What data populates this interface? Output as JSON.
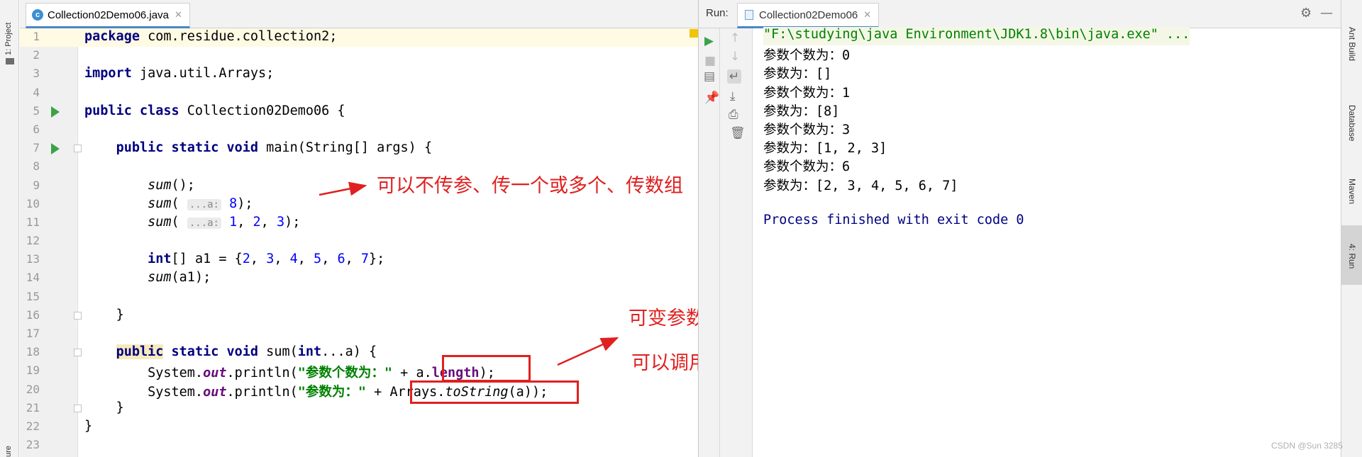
{
  "left_strip": {
    "project_label": "1: Project",
    "structure_label": "ure"
  },
  "editor": {
    "tab_label": "Collection02Demo06.java",
    "tab_icon_letter": "c",
    "lines": [
      {
        "no": "1"
      },
      {
        "no": "2"
      },
      {
        "no": "3"
      },
      {
        "no": "4"
      },
      {
        "no": "5"
      },
      {
        "no": "6"
      },
      {
        "no": "7"
      },
      {
        "no": "8"
      },
      {
        "no": "9"
      },
      {
        "no": "10"
      },
      {
        "no": "11"
      },
      {
        "no": "12"
      },
      {
        "no": "13"
      },
      {
        "no": "14"
      },
      {
        "no": "15"
      },
      {
        "no": "16"
      },
      {
        "no": "17"
      },
      {
        "no": "18"
      },
      {
        "no": "19"
      },
      {
        "no": "20"
      },
      {
        "no": "21"
      },
      {
        "no": "22"
      },
      {
        "no": "23"
      }
    ],
    "code": {
      "l1_kw": "package",
      "l1_rest": " com.residue.collection2;",
      "l3_kw": "import",
      "l3_rest": " java.util.Arrays;",
      "l5_kw": "public class",
      "l5_rest": " Collection02Demo06 {",
      "l7_ind": "    ",
      "l7_kw": "public static void",
      "l7_rest": " main(String[] args) {",
      "l9_ind": "        ",
      "l9_fn": "sum",
      "l9_rest": "();",
      "l10_ind": "        ",
      "l10_fn": "sum",
      "l10_open": "( ",
      "l10_hint": "...a:",
      "l10_num": " 8",
      "l10_close": ");",
      "l11_ind": "        ",
      "l11_fn": "sum",
      "l11_open": "( ",
      "l11_hint": "...a:",
      "l11_n1": " 1",
      "l11_c1": ", ",
      "l11_n2": "2",
      "l11_c2": ", ",
      "l11_n3": "3",
      "l11_close": ");",
      "l13_ind": "        ",
      "l13_kw": "int",
      "l13_a": "[] a1 = {",
      "l13_n1": "2",
      "l13_n2": "3",
      "l13_n3": "4",
      "l13_n4": "5",
      "l13_n5": "6",
      "l13_n6": "7",
      "l13_sep": ", ",
      "l13_end": "};",
      "l14_ind": "        ",
      "l14_fn": "sum",
      "l14_rest": "(a1);",
      "l16_ind": "    ",
      "l16_rest": "}",
      "l18_ind": "    ",
      "l18_kw1": "public",
      "l18_kw2": " static void",
      "l18_a": " sum(",
      "l18_kw3": "int",
      "l18_b": "...a) {",
      "l19_ind": "        ",
      "l19_a": "System.",
      "l19_out": "out",
      "l19_b": ".println(",
      "l19_str": "\"参数个数为：\"",
      "l19_c": " + a.",
      "l19_len": "length",
      "l19_d": ");",
      "l20_ind": "        ",
      "l20_a": "System.",
      "l20_out": "out",
      "l20_b": ".println(",
      "l20_str": "\"参数为：\"",
      "l20_c": " + Arrays.",
      "l20_fn": "toString",
      "l20_d": "(a));",
      "l21_ind": "    ",
      "l21_rest": "}",
      "l22_rest": "}"
    }
  },
  "annotations": {
    "a1": "可以不传参、传一个或多个、传数组",
    "a2": "可变参数在方法内部其实就是一个数组",
    "a3": "可以调用数组的方法"
  },
  "run_panel": {
    "label": "Run:",
    "tab_label": "Collection02Demo06",
    "console": [
      "\"F:\\studying\\java Environment\\JDK1.8\\bin\\java.exe\" ...",
      "参数个数为：0",
      "参数为：[]",
      "参数个数为：1",
      "参数为：[8]",
      "参数个数为：3",
      "参数为：[1, 2, 3]",
      "参数个数为：6",
      "参数为：[2, 3, 4, 5, 6, 7]",
      "",
      "Process finished with exit code 0"
    ]
  },
  "right_strip": {
    "ant": "Ant Build",
    "database": "Database",
    "maven": "Maven",
    "run": "4: Run"
  },
  "watermark": "CSDN @Sun 3285",
  "colors": {
    "keyword": "#000080",
    "number": "#0000ff",
    "string": "#008000",
    "annotation": "#e02020",
    "field": "#660e7a"
  },
  "icons": [
    "class-icon",
    "run-icon",
    "fold-icon",
    "gear-icon",
    "minimize-icon",
    "rerun-icon",
    "stop-icon",
    "up-icon",
    "down-icon",
    "soft-wrap-icon",
    "scroll-end-icon",
    "print-icon",
    "trash-icon",
    "pin-icon",
    "layout-icon"
  ]
}
